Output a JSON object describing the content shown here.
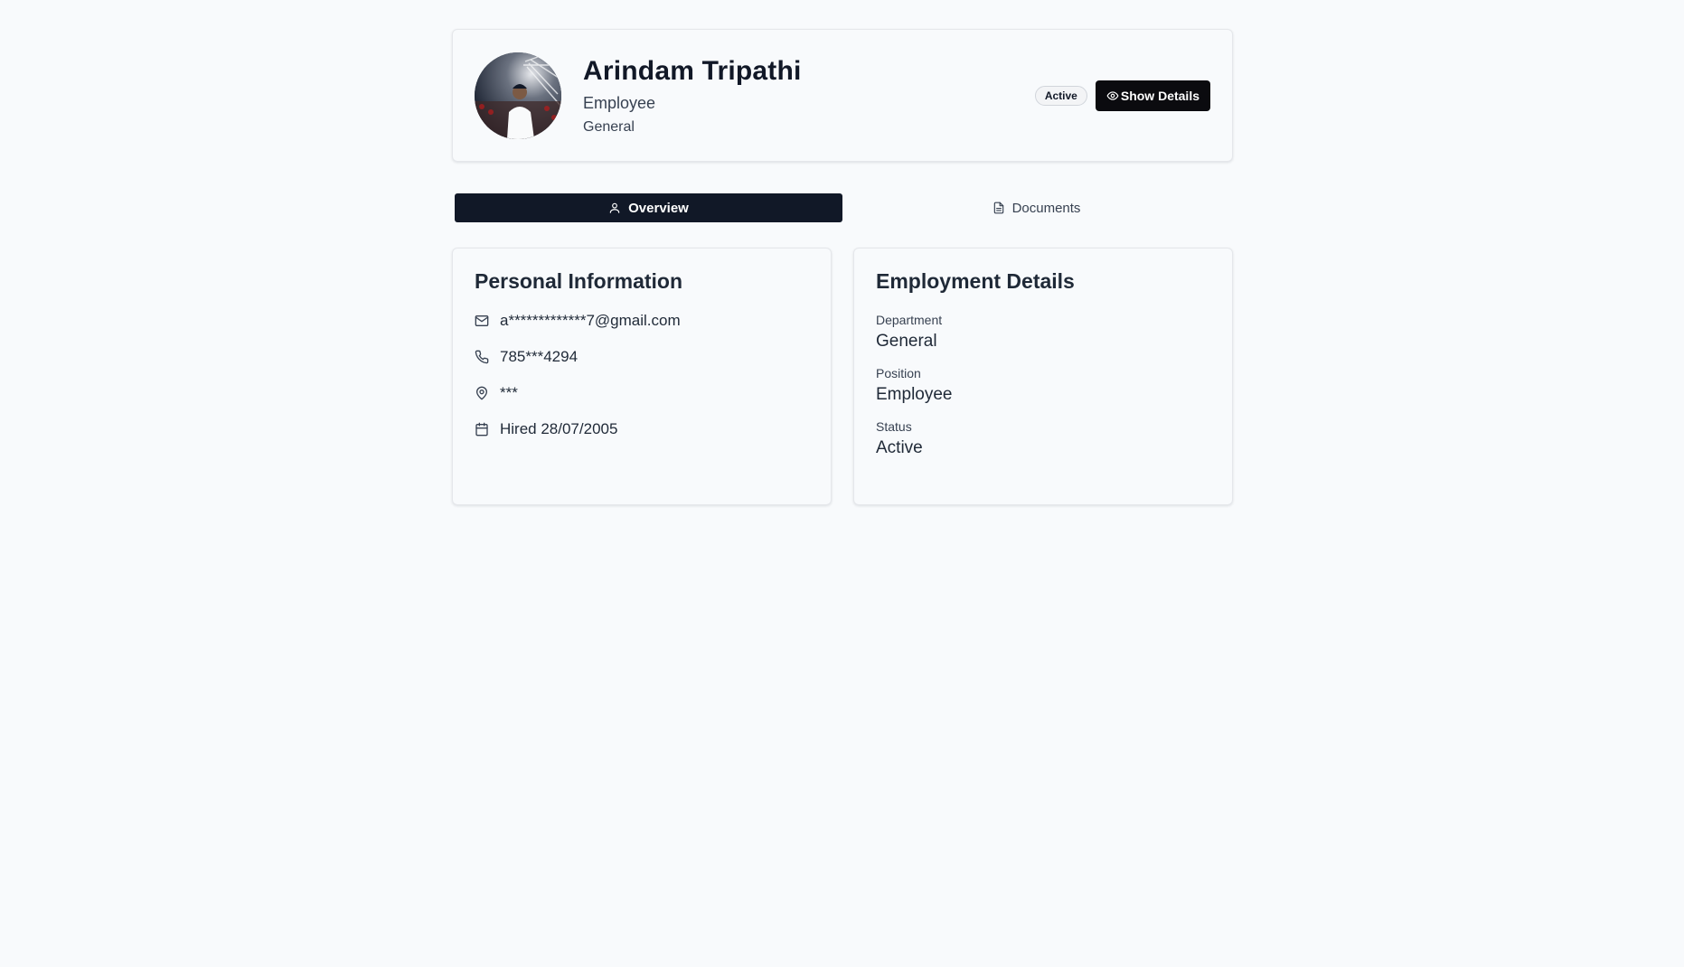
{
  "profile": {
    "name": "Arindam Tripathi",
    "role": "Employee",
    "department": "General",
    "status_badge": "Active",
    "show_details_label": "Show Details"
  },
  "tabs": [
    {
      "label": "Overview",
      "icon": "user-icon",
      "active": true
    },
    {
      "label": "Documents",
      "icon": "file-text-icon",
      "active": false
    }
  ],
  "personal": {
    "title": "Personal Information",
    "email": "a*************7@gmail.com",
    "phone": "785***4294",
    "address": "***",
    "hired": "Hired 28/07/2005"
  },
  "employment": {
    "title": "Employment Details",
    "fields": [
      {
        "label": "Department",
        "value": "General"
      },
      {
        "label": "Position",
        "value": "Employee"
      },
      {
        "label": "Status",
        "value": "Active"
      }
    ]
  },
  "colors": {
    "background": "#f8fafc",
    "active_tab": "#111827",
    "primary_button": "#0b0b0f"
  }
}
